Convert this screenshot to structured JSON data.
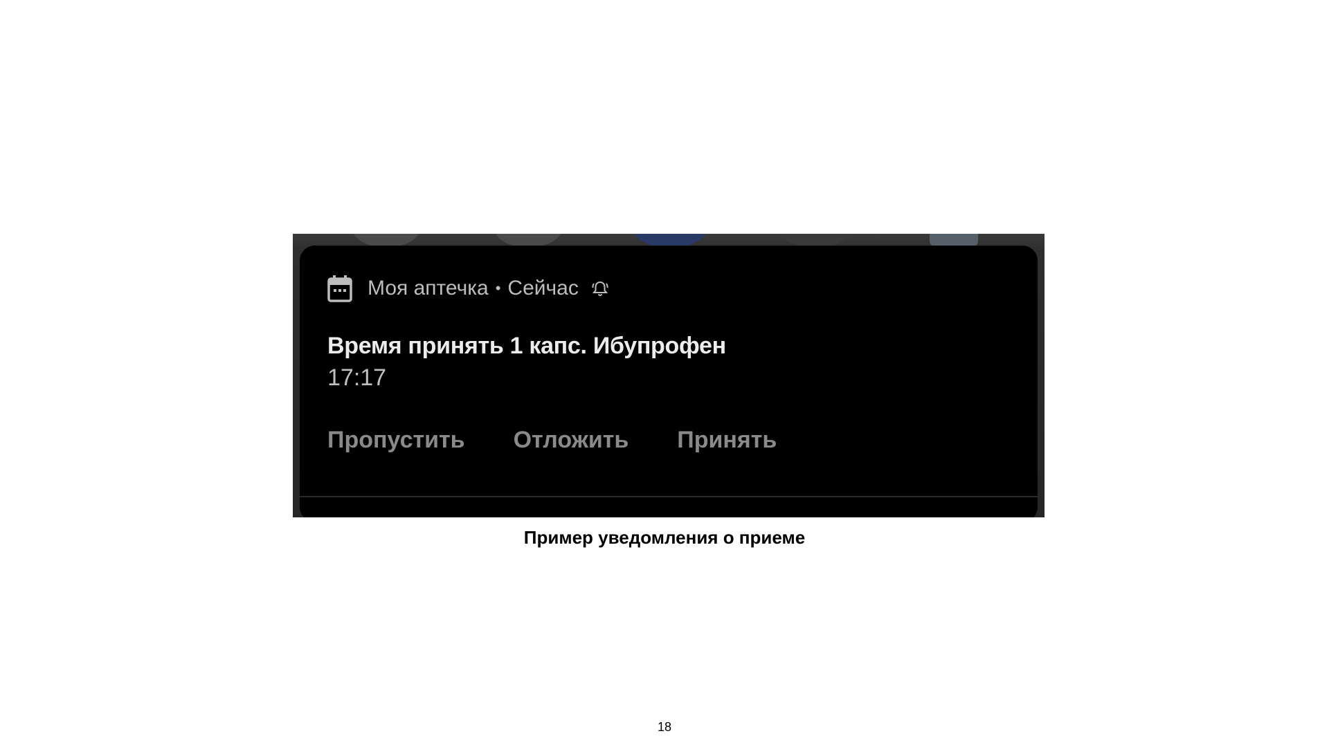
{
  "notification": {
    "app_name": "Моя аптечка",
    "separator": "•",
    "time_label": "Сейчас",
    "title": "Время принять 1 капс. Ибупрофен",
    "time": "17:17",
    "icons": {
      "app": "calendar-icon",
      "status": "bell-icon"
    },
    "actions": [
      {
        "label": "Пропустить"
      },
      {
        "label": "Отложить"
      },
      {
        "label": "Принять"
      }
    ]
  },
  "caption": "Пример уведомления о приеме",
  "page_number": "18",
  "colors": {
    "page_background": "#ffffff",
    "notification_background": "#000000",
    "action_text": "#8a8a8a"
  }
}
